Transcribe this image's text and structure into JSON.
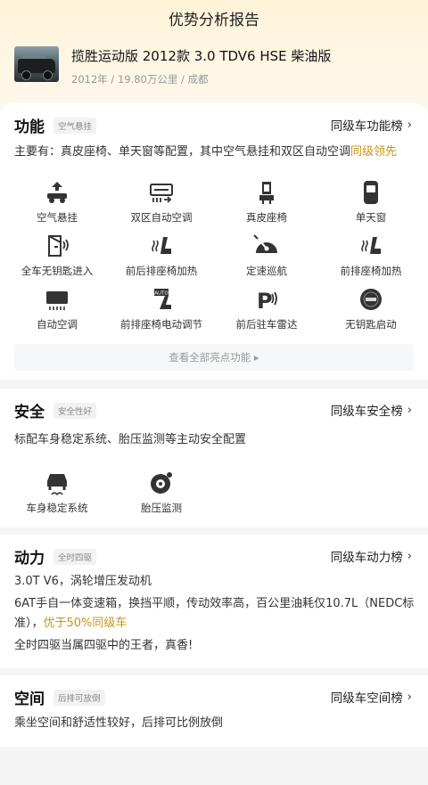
{
  "header": {
    "title": "优势分析报告"
  },
  "car": {
    "name": "揽胜运动版 2012款 3.0 TDV6 HSE 柴油版",
    "meta": "2012年 / 19.80万公里 / 成都"
  },
  "function_section": {
    "title": "功能",
    "tag": "空气悬挂",
    "rank_link": "同级车功能榜",
    "summary_prefix": "主要有：真皮座椅、单天窗等配置，其中空气悬挂和双区自动空调",
    "summary_highlight": "同级领先",
    "features": [
      {
        "label": "空气悬挂",
        "icon": "air-suspension-icon"
      },
      {
        "label": "双区自动空调",
        "icon": "dual-zone-ac-icon"
      },
      {
        "label": "真皮座椅",
        "icon": "leather-seat-icon"
      },
      {
        "label": "单天窗",
        "icon": "sunroof-icon"
      },
      {
        "label": "全车无钥匙进入",
        "icon": "keyless-entry-icon"
      },
      {
        "label": "前后排座椅加热",
        "icon": "seat-heating-icon"
      },
      {
        "label": "定速巡航",
        "icon": "cruise-control-icon"
      },
      {
        "label": "前排座椅加热",
        "icon": "front-seat-heating-icon"
      },
      {
        "label": "自动空调",
        "icon": "auto-ac-icon"
      },
      {
        "label": "前排座椅电动调节",
        "icon": "power-seat-icon"
      },
      {
        "label": "前后驻车雷达",
        "icon": "parking-radar-icon"
      },
      {
        "label": "无钥匙启动",
        "icon": "keyless-start-icon"
      }
    ],
    "more_button": "查看全部亮点功能 ▸"
  },
  "safety_section": {
    "title": "安全",
    "tag": "安全性好",
    "rank_link": "同级车安全榜",
    "summary": "标配车身稳定系统、胎压监测等主动安全配置",
    "features": [
      {
        "label": "车身稳定系统",
        "icon": "stability-control-icon"
      },
      {
        "label": "胎压监测",
        "icon": "tire-pressure-icon"
      }
    ]
  },
  "power_section": {
    "title": "动力",
    "tag": "全时四驱",
    "rank_link": "同级车动力榜",
    "line1": "3.0T V6，涡轮增压发动机",
    "line2_prefix": "6AT手自一体变速箱，换挡平顺，传动效率高，百公里油耗仅10.7L（NEDC标准），",
    "line2_highlight": "优于50%同级车",
    "line3": "全时四驱当属四驱中的王者，真香!"
  },
  "space_section": {
    "title": "空间",
    "tag": "后排可放倒",
    "rank_link": "同级车空间榜",
    "summary": "乘坐空间和舒适性较好，后排可比例放倒"
  },
  "colors": {
    "accent": "#c8941c",
    "hero_bg": "#fff3d8"
  }
}
